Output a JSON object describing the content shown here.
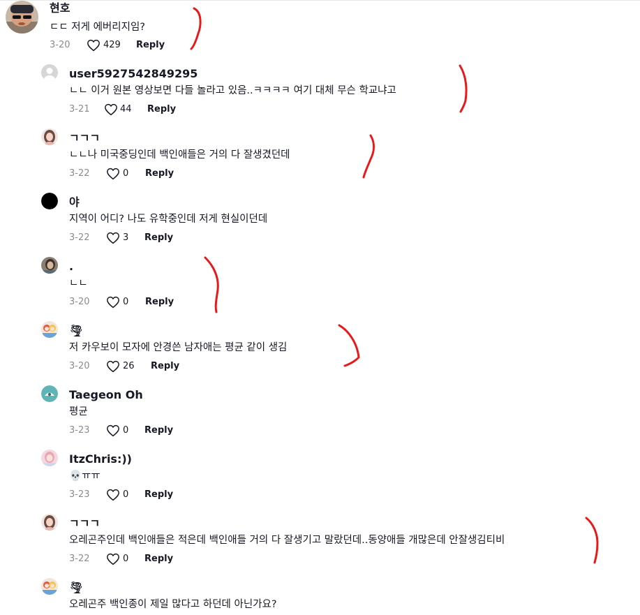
{
  "comments": [
    {
      "username": "현호",
      "text": "ㄷㄷ 저게 에버리지임?",
      "date": "3-20",
      "likes": "429",
      "reply": "Reply",
      "avatar": "user-photo"
    },
    {
      "username": "user5927542849295",
      "text": "ㄴㄴ 이거 원본 영상보면 다들 놀라고 있음..ㅋㅋㅋㅋ 여기 대체 무슨 학교냐고",
      "date": "3-21",
      "likes": "44",
      "reply": "Reply",
      "avatar": "default-gray"
    },
    {
      "username": "ㄱㄱㄱ",
      "text": "ㄴㄴ나 미국중딩인데 백인애들은 거의 다 잘생겼던데",
      "date": "3-22",
      "likes": "0",
      "reply": "Reply",
      "avatar": "woman-photo"
    },
    {
      "username": "야",
      "text": "지역이 어디? 나도 유학중인데 저게 현실이던데",
      "date": "3-22",
      "likes": "3",
      "reply": "Reply",
      "avatar": "black-circle"
    },
    {
      "username": ".",
      "text": "ㄴㄴ",
      "date": "3-20",
      "likes": "0",
      "reply": "Reply",
      "avatar": "person-photo"
    },
    {
      "username": "🌪",
      "text": "저 카우보이 모자에 안경쓴 남자애는 평균 같이 생김",
      "date": "3-20",
      "likes": "26",
      "reply": "Reply",
      "avatar": "cartoon-photo"
    },
    {
      "username": "Taegeon Oh",
      "text": "평균",
      "date": "3-23",
      "likes": "0",
      "reply": "Reply",
      "avatar": "teal-default"
    },
    {
      "username": "ItzChris:))",
      "text": "💀ㅠㅠ",
      "date": "3-23",
      "likes": "0",
      "reply": "Reply",
      "avatar": "pink-photo"
    },
    {
      "username": "ㄱㄱㄱ",
      "text": "오레곤주인데 백인애들은 적은데 백인애들 거의 다 잘생기고 말랐던데..동양애들 개많은데 안잘생김티비",
      "date": "3-22",
      "likes": "0",
      "reply": "Reply",
      "avatar": "woman-photo"
    },
    {
      "username": "🌪",
      "text": "오레곤주 백인종이 제일 많다고 하던데 아닌가요?",
      "date": "",
      "likes": "",
      "reply": "",
      "avatar": "cartoon-photo"
    }
  ],
  "icons": {
    "like": "heart-outline-icon"
  },
  "colors": {
    "annotation": "#e8191b",
    "meta": "#8a8b91",
    "text": "#161823"
  }
}
